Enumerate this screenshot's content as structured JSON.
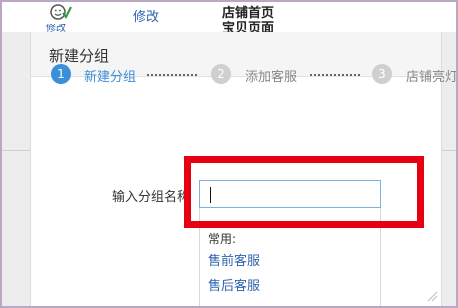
{
  "background": {
    "edit_link": "修改",
    "cut_icon_label": "修改",
    "title_line1": "店铺首页",
    "title_line2": "宝贝页面"
  },
  "dialog": {
    "title": "新建分组",
    "steps": [
      {
        "number": "1",
        "label": "新建分组",
        "active": true
      },
      {
        "number": "2",
        "label": "添加客服",
        "active": false
      },
      {
        "number": "3",
        "label": "店铺亮灯",
        "active": false
      }
    ],
    "name_field_label": "输入分组名称",
    "name_field_value": "",
    "suggestions": {
      "heading": "常用:",
      "items": [
        "售前客服",
        "售后客服"
      ]
    }
  },
  "colors": {
    "step_active": "#3b8fd8",
    "step_inactive": "#cfcfcf",
    "link": "#2c62b0",
    "highlight": "#e60012"
  },
  "icons": {
    "edit": "smiley-check-icon"
  }
}
